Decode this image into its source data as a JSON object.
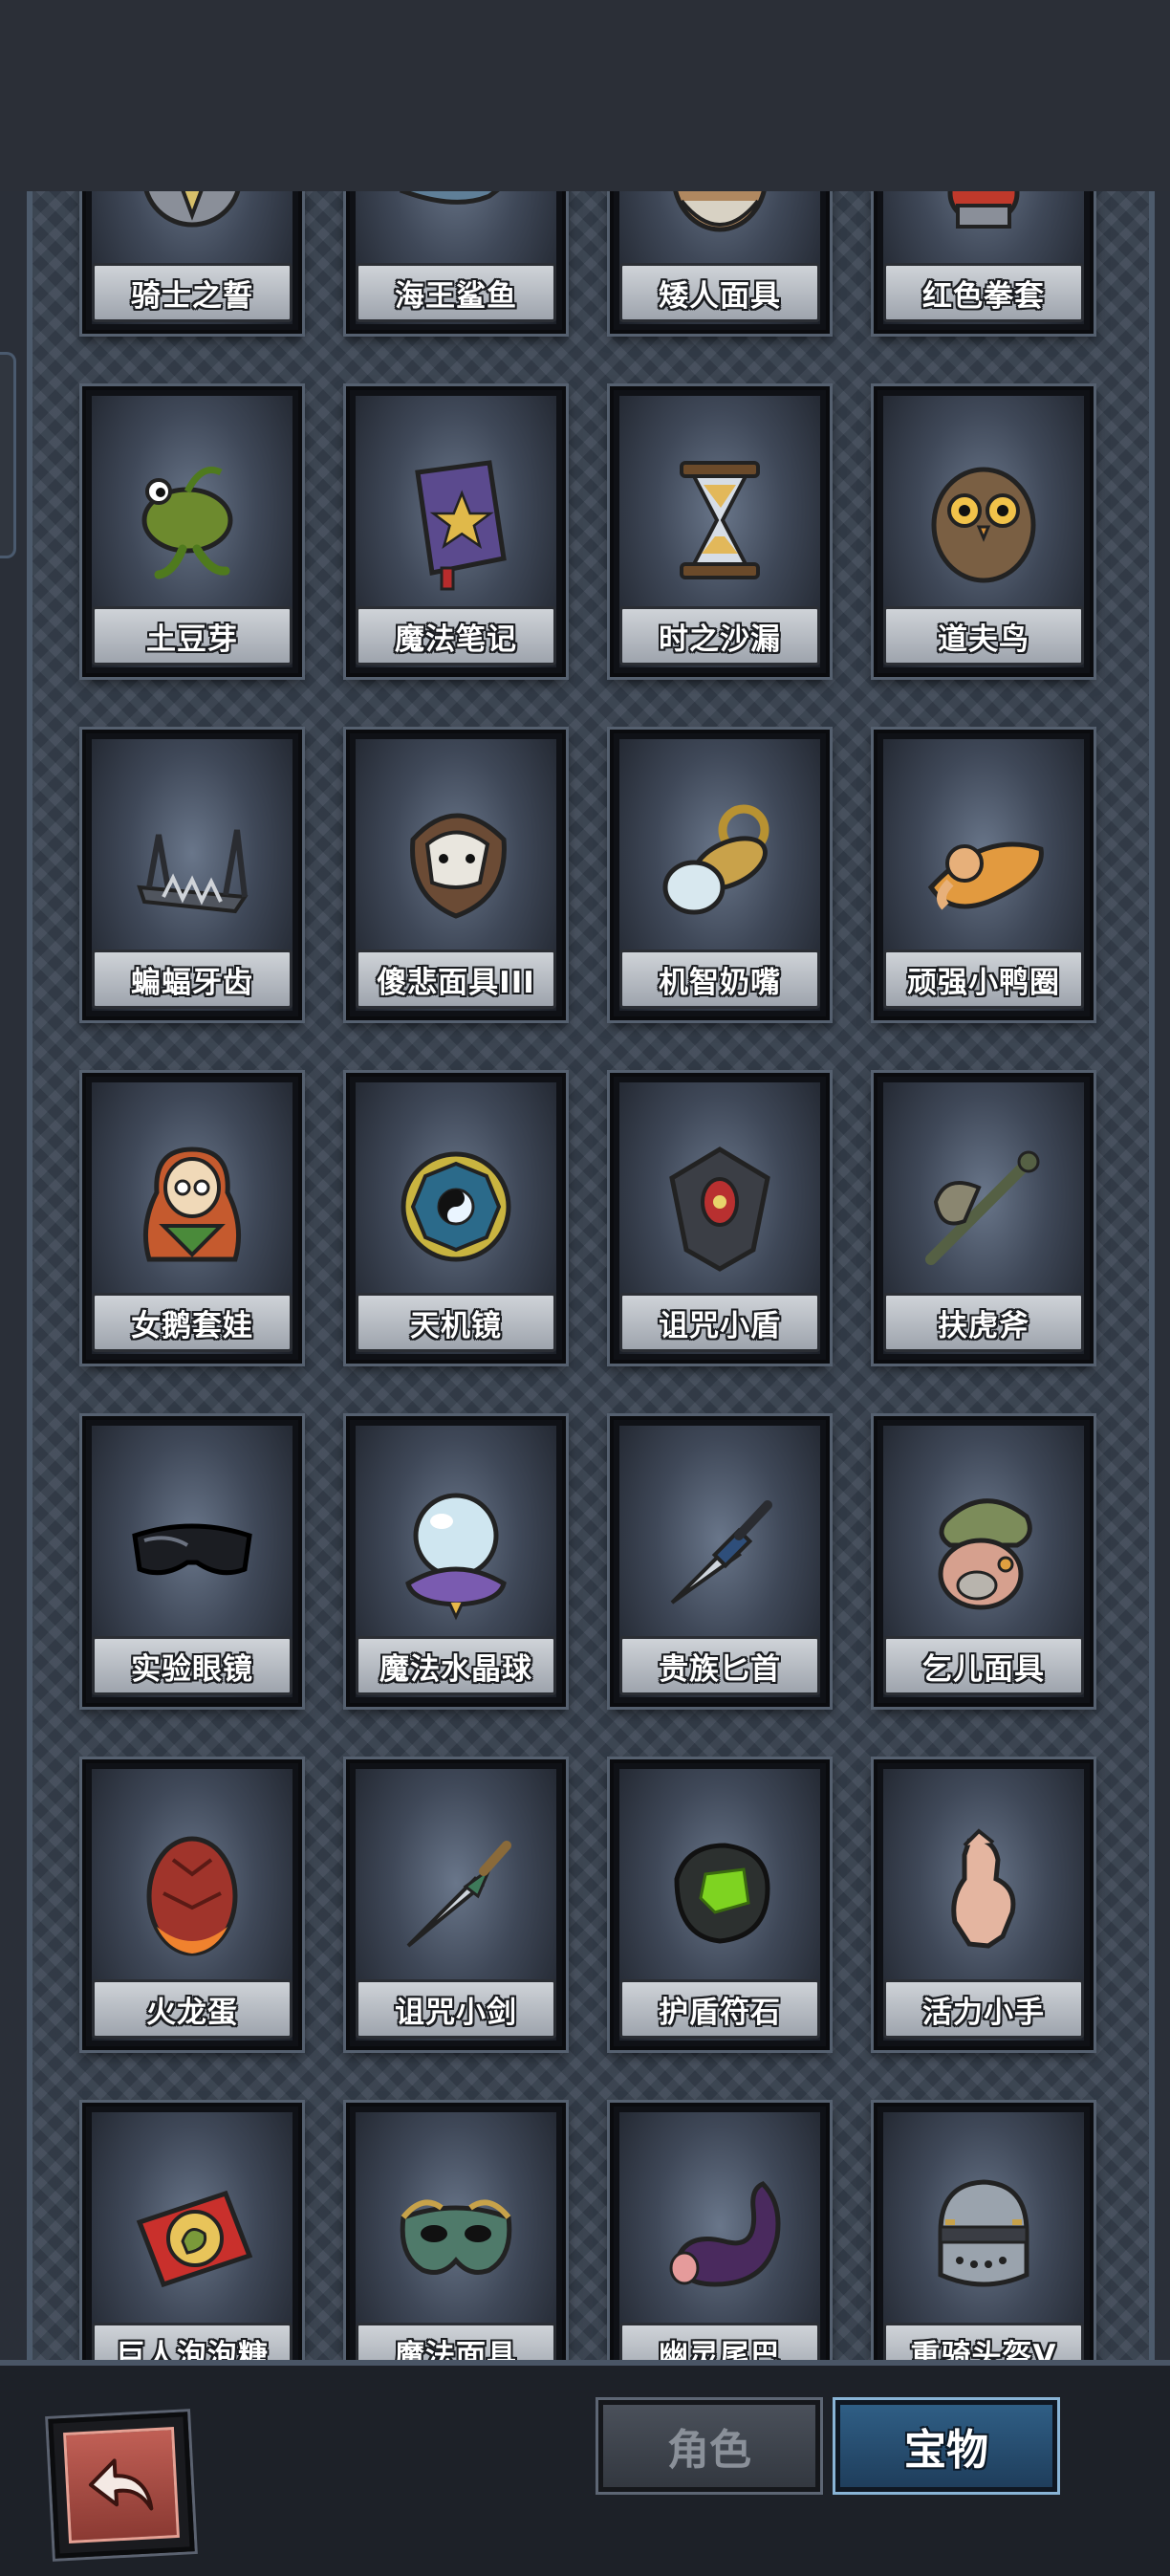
{
  "items": [
    {
      "name": "骑士之誓",
      "icon": "knight-oath-icon"
    },
    {
      "name": "海王鲨鱼",
      "icon": "sea-king-shark-icon"
    },
    {
      "name": "矮人面具",
      "icon": "dwarf-mask-icon"
    },
    {
      "name": "红色拳套",
      "icon": "red-glove-icon"
    },
    {
      "name": "土豆芽",
      "icon": "potato-sprout-icon"
    },
    {
      "name": "魔法笔记",
      "icon": "magic-notebook-icon"
    },
    {
      "name": "时之沙漏",
      "icon": "hourglass-icon"
    },
    {
      "name": "道夫鸟",
      "icon": "owl-bird-icon"
    },
    {
      "name": "蝙蝠牙齿",
      "icon": "bat-teeth-icon"
    },
    {
      "name": "傻悲面具III",
      "icon": "sad-mask-icon"
    },
    {
      "name": "机智奶嘴",
      "icon": "pacifier-icon"
    },
    {
      "name": "顽强小鸭圈",
      "icon": "duck-ring-icon"
    },
    {
      "name": "女鹅套娃",
      "icon": "nesting-doll-icon"
    },
    {
      "name": "天机镜",
      "icon": "bagua-mirror-icon"
    },
    {
      "name": "诅咒小盾",
      "icon": "cursed-shield-icon"
    },
    {
      "name": "扶虎斧",
      "icon": "tiger-axe-icon"
    },
    {
      "name": "实验眼镜",
      "icon": "lab-goggles-icon"
    },
    {
      "name": "魔法水晶球",
      "icon": "crystal-ball-icon"
    },
    {
      "name": "贵族匕首",
      "icon": "noble-dagger-icon"
    },
    {
      "name": "乞儿面具",
      "icon": "beggar-mask-icon"
    },
    {
      "name": "火龙蛋",
      "icon": "fire-dragon-egg-icon"
    },
    {
      "name": "诅咒小剑",
      "icon": "cursed-sword-icon"
    },
    {
      "name": "护盾符石",
      "icon": "shield-rune-stone-icon"
    },
    {
      "name": "活力小手",
      "icon": "vital-hand-icon"
    },
    {
      "name": "巨人泡泡糖",
      "icon": "giant-bubblegum-icon"
    },
    {
      "name": "魔法面具",
      "icon": "magic-mask-icon"
    },
    {
      "name": "幽灵尾巴",
      "icon": "ghost-tail-icon"
    },
    {
      "name": "重骑头盔V",
      "icon": "heavy-knight-helmet-icon"
    }
  ],
  "bottom_bar": {
    "back_icon": "return-arrow-icon",
    "tab_character": "角色",
    "tab_treasure": "宝物",
    "active_tab": "宝物"
  },
  "colors": {
    "background": "#2a2f38",
    "panel": "#3a4452",
    "active_tab": "#2f5e85",
    "back_button": "#c05f55"
  }
}
